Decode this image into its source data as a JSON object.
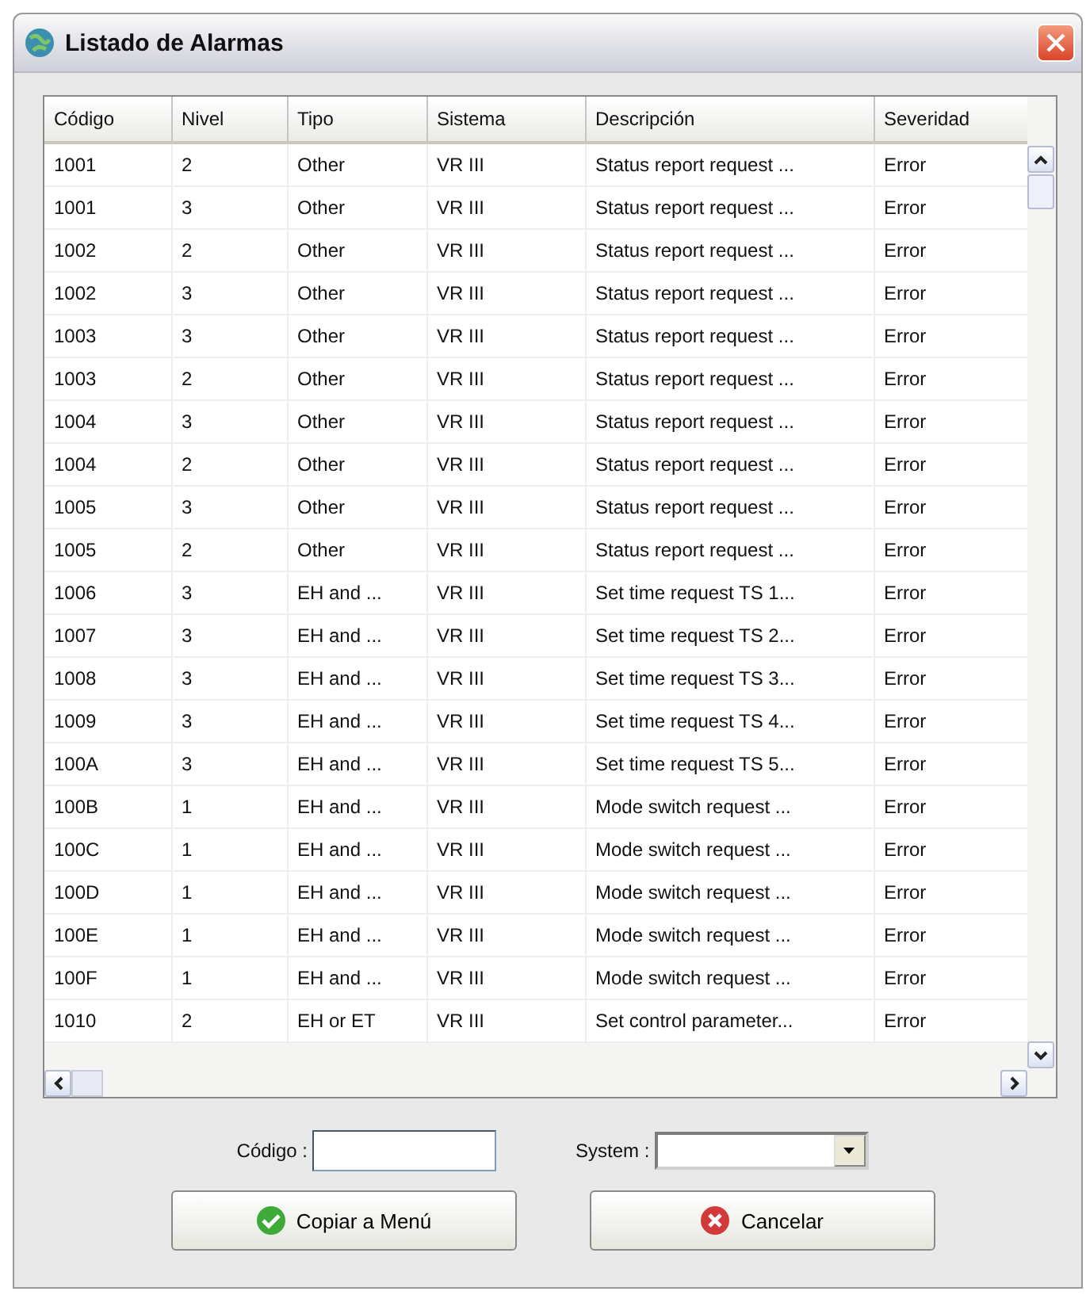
{
  "window": {
    "title": "Listado de Alarmas"
  },
  "table": {
    "columns": [
      "Código",
      "Nivel",
      "Tipo",
      "Sistema",
      "Descripción",
      "Severidad"
    ],
    "rows": [
      [
        "1001",
        "2",
        "Other",
        "VR III",
        "Status report request ...",
        "Error"
      ],
      [
        "1001",
        "3",
        "Other",
        "VR III",
        "Status report request ...",
        "Error"
      ],
      [
        "1002",
        "2",
        "Other",
        "VR III",
        "Status report request ...",
        "Error"
      ],
      [
        "1002",
        "3",
        "Other",
        "VR III",
        "Status report request ...",
        "Error"
      ],
      [
        "1003",
        "3",
        "Other",
        "VR III",
        "Status report request ...",
        "Error"
      ],
      [
        "1003",
        "2",
        "Other",
        "VR III",
        "Status report request ...",
        "Error"
      ],
      [
        "1004",
        "3",
        "Other",
        "VR III",
        "Status report request ...",
        "Error"
      ],
      [
        "1004",
        "2",
        "Other",
        "VR III",
        "Status report request ...",
        "Error"
      ],
      [
        "1005",
        "3",
        "Other",
        "VR III",
        "Status report request ...",
        "Error"
      ],
      [
        "1005",
        "2",
        "Other",
        "VR III",
        "Status report request ...",
        "Error"
      ],
      [
        "1006",
        "3",
        "EH and ...",
        "VR III",
        "Set time request TS 1...",
        "Error"
      ],
      [
        "1007",
        "3",
        "EH and ...",
        "VR III",
        "Set time request TS 2...",
        "Error"
      ],
      [
        "1008",
        "3",
        "EH and ...",
        "VR III",
        "Set time request TS 3...",
        "Error"
      ],
      [
        "1009",
        "3",
        "EH and ...",
        "VR III",
        "Set time request TS 4...",
        "Error"
      ],
      [
        "100A",
        "3",
        "EH and ...",
        "VR III",
        "Set time request TS 5...",
        "Error"
      ],
      [
        "100B",
        "1",
        "EH and ...",
        "VR III",
        "Mode switch request ...",
        "Error"
      ],
      [
        "100C",
        "1",
        "EH and ...",
        "VR III",
        "Mode switch request ...",
        "Error"
      ],
      [
        "100D",
        "1",
        "EH and ...",
        "VR III",
        "Mode switch request ...",
        "Error"
      ],
      [
        "100E",
        "1",
        "EH and ...",
        "VR III",
        "Mode switch request ...",
        "Error"
      ],
      [
        "100F",
        "1",
        "EH and ...",
        "VR III",
        "Mode switch request ...",
        "Error"
      ],
      [
        "1010",
        "2",
        "EH or ET",
        "VR III",
        "Set control parameter...",
        "Error"
      ]
    ]
  },
  "filters": [
    {
      "kind": "text",
      "label": "Código :"
    },
    {
      "kind": "dropdown",
      "label": "System :"
    }
  ],
  "buttons": [
    {
      "kind": "ok",
      "label": "Copiar a Menú"
    },
    {
      "kind": "cancel",
      "label": "Cancelar"
    }
  ]
}
